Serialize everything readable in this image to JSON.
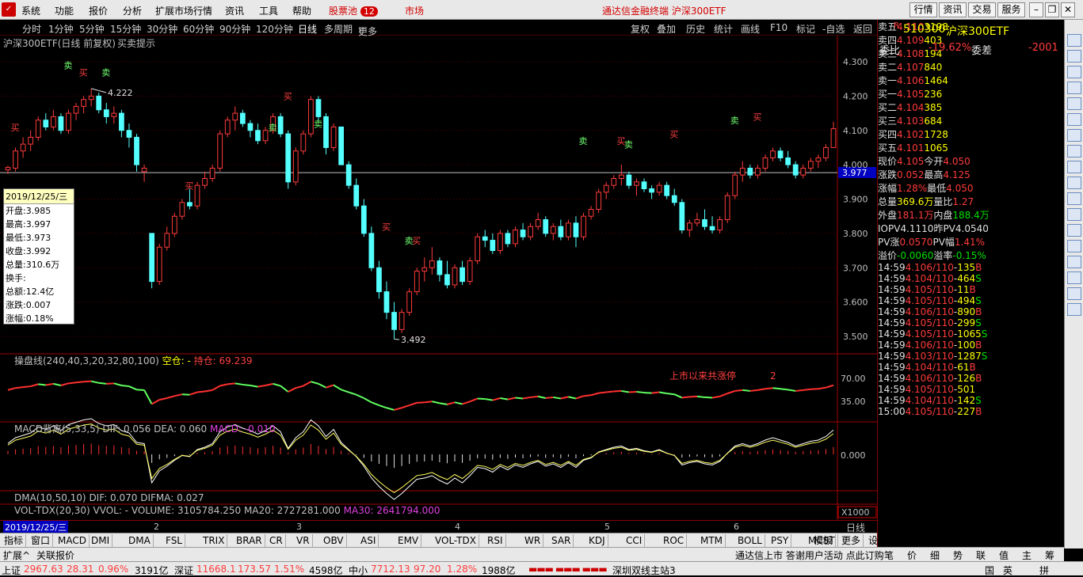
{
  "menu": {
    "logo": "通达信",
    "items": [
      "系统",
      "功能",
      "报价",
      "分析",
      "扩展市场行情",
      "资讯",
      "工具",
      "帮助"
    ],
    "stockpool": "股票池",
    "stockpool_count": "12",
    "market": "市场",
    "title": "通达信金融终端  沪深300ETF",
    "buttons": [
      "行情",
      "资讯",
      "交易",
      "服务"
    ]
  },
  "periods": {
    "items": [
      "分时",
      "1分钟",
      "5分钟",
      "15分钟",
      "30分钟",
      "60分钟",
      "90分钟",
      "120分钟",
      "日线",
      "多周期",
      "更多"
    ],
    "active": "日线",
    "tools": [
      "复权",
      "叠加",
      "历史",
      "统计",
      "画线",
      "F10",
      "标记",
      "-自选",
      "返回"
    ]
  },
  "chart_header": {
    "title": "沪深300ETF(日线 前复权)",
    "signal": "买卖提示"
  },
  "price_axis": {
    "ticks": [
      "4.300",
      "4.200",
      "4.100",
      "4.000",
      "3.900",
      "3.800",
      "3.700",
      "3.600",
      "3.500"
    ],
    "current_label": "3.977",
    "high_label": "4.222",
    "low_label": "3.492"
  },
  "buy_label": "买",
  "sell_label": "卖",
  "infobox": {
    "date": "2019/12/25/三",
    "rows": [
      "开盘:3.985",
      "最高:3.997",
      "最低:3.973",
      "收盘:3.992",
      "总量:310.6万",
      "换手:",
      "总额:12.4亿",
      "涨跌:0.007",
      "涨幅:0.18%"
    ]
  },
  "ind1": {
    "title": "操盘线(240,40,3,20,32,80,100)",
    "k1": "空仓: -",
    "k2": "持仓: 69.239",
    "ticks": [
      "70.00",
      "35.00"
    ],
    "note": "上市以来共涨停",
    "note2": "2"
  },
  "ind2": {
    "title": "MACD背离(5,33,5)",
    "dif": "DIF: 0.056",
    "dea": "DEA: 0.060",
    "macd": "MACD: -0.010",
    "tick": "0.000"
  },
  "ind3": {
    "title": "DMA(10,50,10)",
    "dif": "DIF: 0.070",
    "difma": "DIFMA: 0.027"
  },
  "ind4": {
    "title": "VOL-TDX(20,30)",
    "vvol": "VVOL: -",
    "volume": "VOLUME: 3105784.250",
    "ma20": "MA20: 2727281.000",
    "ma30": "MA30: 2641794.000",
    "unit": "X1000"
  },
  "date_axis": {
    "cursor": "2019/12/25/三",
    "labels": [
      "2",
      "3",
      "4",
      "5",
      "6"
    ],
    "period": "日线"
  },
  "tabs": [
    "指标",
    "窗口",
    "MACD",
    "DMI",
    "DMA",
    "FSL",
    "TRIX",
    "BRAR",
    "CR",
    "VR",
    "OBV",
    "ASI",
    "EMV",
    "VOL-TDX",
    "RSI",
    "WR",
    "SAR",
    "KDJ",
    "CCI",
    "ROC",
    "MTM",
    "BOLL",
    "PSY",
    "MCST",
    "更多",
    "设置"
  ],
  "tab_right": "模板",
  "quote": {
    "code": "510300",
    "name": "沪深300ETF",
    "webi": "委比",
    "webi_v": "-19.62%",
    "wecha": "委差",
    "wecha_v": "-2001",
    "asks": [
      [
        "卖五",
        "4.110",
        "3198"
      ],
      [
        "卖四",
        "4.109",
        "403"
      ],
      [
        "卖三",
        "4.108",
        "194"
      ],
      [
        "卖二",
        "4.107",
        "840"
      ],
      [
        "卖一",
        "4.106",
        "1464"
      ]
    ],
    "bids": [
      [
        "买一",
        "4.105",
        "236"
      ],
      [
        "买二",
        "4.104",
        "385"
      ],
      [
        "买三",
        "4.103",
        "684"
      ],
      [
        "买四",
        "4.102",
        "1728"
      ],
      [
        "买五",
        "4.101",
        "1065"
      ]
    ],
    "stats": [
      [
        "现价",
        "4.105",
        "今开",
        "4.050"
      ],
      [
        "涨跌",
        "0.052",
        "最高",
        "4.125"
      ],
      [
        "涨幅",
        "1.28%",
        "最低",
        "4.050"
      ],
      [
        "总量",
        "369.6万",
        "量比",
        "1.27"
      ],
      [
        "外盘",
        "181.1万",
        "内盘",
        "188.4万"
      ]
    ],
    "iopv": [
      [
        "IOPV",
        "4.1110",
        "昨PV",
        "4.0540"
      ],
      [
        "PV涨",
        "0.0570",
        "PV幅",
        "1.41%"
      ],
      [
        "溢价",
        "-0.0060",
        "溢率",
        "-0.15%"
      ]
    ],
    "ticks": [
      [
        "14:59",
        "4.106/110",
        "-",
        "135",
        "B"
      ],
      [
        "14:59",
        "4.104/110",
        "-",
        "464",
        "S"
      ],
      [
        "14:59",
        "4.105/110",
        "-",
        "11",
        "B"
      ],
      [
        "14:59",
        "4.105/110",
        "-",
        "494",
        "S"
      ],
      [
        "14:59",
        "4.106/110",
        "-",
        "890",
        "B"
      ],
      [
        "14:59",
        "4.105/110",
        "-",
        "299",
        "S"
      ],
      [
        "14:59",
        "4.105/110",
        "-",
        "1065",
        "S"
      ],
      [
        "14:59",
        "4.106/110",
        "-",
        "100",
        "B"
      ],
      [
        "14:59",
        "4.103/110",
        "-",
        "1287",
        "S"
      ],
      [
        "14:59",
        "4.104/110",
        "-",
        "61",
        "B"
      ],
      [
        "14:59",
        "4.106/110",
        "-",
        "126",
        "B"
      ],
      [
        "14:59",
        "4.105/110",
        "-",
        "501",
        ""
      ],
      [
        "14:59",
        "4.104/110",
        "-",
        "142",
        "S"
      ],
      [
        "15:00",
        "4.105/110",
        "-",
        "227",
        "B"
      ]
    ]
  },
  "bottom": {
    "left": [
      "扩展^",
      "关联报价"
    ],
    "marquee": "通达信上市 答谢用户活动 点此订购",
    "tabs": [
      "笔",
      "价",
      "细",
      "势",
      "联",
      "值",
      "主",
      "筹"
    ]
  },
  "status": {
    "sh": "上证",
    "sh_v": "2967.63",
    "sh_c": "28.31",
    "sh_p": "0.96%",
    "sh_a": "3191亿",
    "sz": "深证",
    "sz_v": "11668.1",
    "sz_c": "173.57",
    "sz_p": "1.51%",
    "sz_a": "4598亿",
    "zx": "中小",
    "zx_v": "7712.13",
    "zx_c": "97.20",
    "zx_p": "1.28%",
    "zx_a": "1988亿",
    "conn": "深圳双线主站3",
    "ime": [
      "国",
      "英",
      "拼"
    ]
  },
  "chart_data": {
    "type": "candlestick",
    "series": "沪深300ETF 日线",
    "y_ticks": [
      4.3,
      4.2,
      4.1,
      4.0,
      3.9,
      3.8,
      3.7,
      3.6,
      3.5
    ],
    "high": 4.222,
    "low": 3.492,
    "current": 3.977,
    "ohlc": [
      [
        3.985,
        3.997,
        3.973,
        3.992
      ],
      [
        3.99,
        4.05,
        3.98,
        4.04
      ],
      [
        4.04,
        4.08,
        4.02,
        4.06
      ],
      [
        4.06,
        4.1,
        4.04,
        4.08
      ],
      [
        4.08,
        4.14,
        4.07,
        4.13
      ],
      [
        4.13,
        4.15,
        4.1,
        4.11
      ],
      [
        4.11,
        4.16,
        4.1,
        4.14
      ],
      [
        4.14,
        4.15,
        4.09,
        4.1
      ],
      [
        4.1,
        4.16,
        4.09,
        4.15
      ],
      [
        4.15,
        4.18,
        4.13,
        4.17
      ],
      [
        4.17,
        4.2,
        4.15,
        4.19
      ],
      [
        4.19,
        4.222,
        4.17,
        4.2
      ],
      [
        4.2,
        4.21,
        4.15,
        4.16
      ],
      [
        4.16,
        4.18,
        4.12,
        4.14
      ],
      [
        4.14,
        4.17,
        4.12,
        4.15
      ],
      [
        4.15,
        4.16,
        4.08,
        4.1
      ],
      [
        4.1,
        4.12,
        4.05,
        4.08
      ],
      [
        4.08,
        4.09,
        3.98,
        4.0
      ],
      [
        3.98,
        4.0,
        3.95,
        3.99
      ],
      [
        3.8,
        3.8,
        3.64,
        3.66
      ],
      [
        3.66,
        3.77,
        3.65,
        3.76
      ],
      [
        3.76,
        3.82,
        3.75,
        3.8
      ],
      [
        3.8,
        3.86,
        3.79,
        3.85
      ],
      [
        3.85,
        3.9,
        3.84,
        3.89
      ],
      [
        3.89,
        3.93,
        3.87,
        3.88
      ],
      [
        3.88,
        3.95,
        3.87,
        3.94
      ],
      [
        3.94,
        3.98,
        3.93,
        3.96
      ],
      [
        3.96,
        4.0,
        3.95,
        3.99
      ],
      [
        3.99,
        4.1,
        3.98,
        4.09
      ],
      [
        4.09,
        4.14,
        4.08,
        4.13
      ],
      [
        4.13,
        4.17,
        4.1,
        4.15
      ],
      [
        4.15,
        4.16,
        4.11,
        4.12
      ],
      [
        4.12,
        4.13,
        4.08,
        4.1
      ],
      [
        4.1,
        4.12,
        4.06,
        4.07
      ],
      [
        4.07,
        4.11,
        4.06,
        4.1
      ],
      [
        4.1,
        4.15,
        4.09,
        4.14
      ],
      [
        4.14,
        4.15,
        4.08,
        4.09
      ],
      [
        4.09,
        4.1,
        3.93,
        3.95
      ],
      [
        3.95,
        4.05,
        3.94,
        4.04
      ],
      [
        4.04,
        4.1,
        4.03,
        4.09
      ],
      [
        4.09,
        4.2,
        4.08,
        4.19
      ],
      [
        4.19,
        4.2,
        4.13,
        4.14
      ],
      [
        4.14,
        4.15,
        4.03,
        4.05
      ],
      [
        4.05,
        4.12,
        4.04,
        4.11
      ],
      [
        4.11,
        4.11,
        4.0,
        4.0
      ],
      [
        4.0,
        4.01,
        3.93,
        3.94
      ],
      [
        3.94,
        3.96,
        3.87,
        3.88
      ],
      [
        3.88,
        3.9,
        3.79,
        3.8
      ],
      [
        3.8,
        3.82,
        3.69,
        3.7
      ],
      [
        3.7,
        3.72,
        3.61,
        3.63
      ],
      [
        3.63,
        3.66,
        3.55,
        3.57
      ],
      [
        3.57,
        3.6,
        3.492,
        3.52
      ],
      [
        3.52,
        3.58,
        3.51,
        3.57
      ],
      [
        3.57,
        3.64,
        3.56,
        3.63
      ],
      [
        3.63,
        3.7,
        3.62,
        3.69
      ],
      [
        3.69,
        3.73,
        3.66,
        3.7
      ],
      [
        3.7,
        3.76,
        3.68,
        3.72
      ],
      [
        3.72,
        3.73,
        3.66,
        3.68
      ],
      [
        3.68,
        3.72,
        3.64,
        3.65
      ],
      [
        3.65,
        3.71,
        3.64,
        3.7
      ],
      [
        3.7,
        3.72,
        3.65,
        3.66
      ],
      [
        3.66,
        3.73,
        3.65,
        3.72
      ],
      [
        3.72,
        3.8,
        3.71,
        3.79
      ],
      [
        3.79,
        3.81,
        3.76,
        3.78
      ],
      [
        3.78,
        3.8,
        3.74,
        3.75
      ],
      [
        3.75,
        3.81,
        3.74,
        3.8
      ],
      [
        3.8,
        3.81,
        3.76,
        3.77
      ],
      [
        3.77,
        3.82,
        3.76,
        3.81
      ],
      [
        3.81,
        3.83,
        3.78,
        3.79
      ],
      [
        3.79,
        3.83,
        3.78,
        3.82
      ],
      [
        3.82,
        3.86,
        3.81,
        3.84
      ],
      [
        3.84,
        3.85,
        3.79,
        3.8
      ],
      [
        3.8,
        3.83,
        3.78,
        3.82
      ],
      [
        3.82,
        3.84,
        3.78,
        3.79
      ],
      [
        3.79,
        3.84,
        3.78,
        3.83
      ],
      [
        3.83,
        3.85,
        3.76,
        3.79
      ],
      [
        3.79,
        3.86,
        3.78,
        3.85
      ],
      [
        3.85,
        3.88,
        3.84,
        3.87
      ],
      [
        3.87,
        3.93,
        3.86,
        3.92
      ],
      [
        3.92,
        3.95,
        3.9,
        3.94
      ],
      [
        3.94,
        3.97,
        3.93,
        3.96
      ],
      [
        3.96,
        4.0,
        3.94,
        3.97
      ],
      [
        3.97,
        3.98,
        3.93,
        3.94
      ],
      [
        3.94,
        3.96,
        3.91,
        3.95
      ],
      [
        3.95,
        3.96,
        3.92,
        3.93
      ],
      [
        3.93,
        3.94,
        3.9,
        3.92
      ],
      [
        3.92,
        3.95,
        3.91,
        3.94
      ],
      [
        3.94,
        3.95,
        3.9,
        3.91
      ],
      [
        3.91,
        3.93,
        3.88,
        3.89
      ],
      [
        3.89,
        3.9,
        3.8,
        3.81
      ],
      [
        3.81,
        3.84,
        3.79,
        3.83
      ],
      [
        3.83,
        3.86,
        3.82,
        3.84
      ],
      [
        3.84,
        3.87,
        3.81,
        3.82
      ],
      [
        3.82,
        3.85,
        3.8,
        3.81
      ],
      [
        3.81,
        3.85,
        3.8,
        3.84
      ],
      [
        3.84,
        3.92,
        3.83,
        3.91
      ],
      [
        3.91,
        3.98,
        3.9,
        3.97
      ],
      [
        3.97,
        4.01,
        3.95,
        3.99
      ],
      [
        3.99,
        4.0,
        3.96,
        3.97
      ],
      [
        3.97,
        4.0,
        3.96,
        3.99
      ],
      [
        3.99,
        4.03,
        3.98,
        4.02
      ],
      [
        4.02,
        4.05,
        4.01,
        4.04
      ],
      [
        4.04,
        4.05,
        4.01,
        4.02
      ],
      [
        4.02,
        4.04,
        3.99,
        4.0
      ],
      [
        4.0,
        4.01,
        3.96,
        3.97
      ],
      [
        3.97,
        4.0,
        3.96,
        3.99
      ],
      [
        3.99,
        4.02,
        3.98,
        4.01
      ],
      [
        4.01,
        4.03,
        3.99,
        4.02
      ],
      [
        4.02,
        4.06,
        4.01,
        4.05
      ],
      [
        4.05,
        4.125,
        4.05,
        4.105
      ]
    ]
  }
}
